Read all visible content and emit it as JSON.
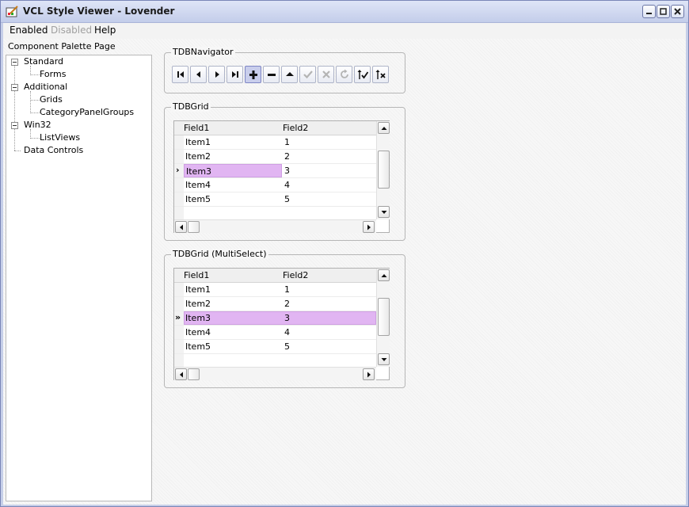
{
  "window": {
    "title": "VCL Style Viewer - Lovender",
    "icon": "paint-palette-icon",
    "controls": [
      "minimize-icon",
      "maximize-icon",
      "close-icon"
    ]
  },
  "menu": {
    "items": [
      {
        "label": "Enabled",
        "enabled": true
      },
      {
        "label": "Disabled",
        "enabled": false
      },
      {
        "label": "Help",
        "enabled": true
      }
    ]
  },
  "palette": {
    "label": "Component Palette Page",
    "tree": [
      {
        "label": "Standard",
        "children": [
          "Forms"
        ]
      },
      {
        "label": "Additional",
        "children": [
          "Grids",
          "CategoryPanelGroups"
        ]
      },
      {
        "label": "Win32",
        "children": [
          "ListViews"
        ]
      },
      {
        "label": "Data Controls",
        "children": []
      }
    ]
  },
  "navigator": {
    "caption": "TDBNavigator",
    "buttons": [
      {
        "name": "first",
        "icon": "first-record-icon",
        "enabled": true
      },
      {
        "name": "prior",
        "icon": "prior-record-icon",
        "enabled": true
      },
      {
        "name": "next",
        "icon": "next-record-icon",
        "enabled": true
      },
      {
        "name": "last",
        "icon": "last-record-icon",
        "enabled": true
      },
      {
        "name": "insert",
        "icon": "plus-icon",
        "enabled": true,
        "active": true
      },
      {
        "name": "delete",
        "icon": "minus-icon",
        "enabled": true
      },
      {
        "name": "edit",
        "icon": "edit-up-icon",
        "enabled": true
      },
      {
        "name": "post",
        "icon": "check-icon",
        "enabled": false
      },
      {
        "name": "cancel",
        "icon": "cancel-x-icon",
        "enabled": false
      },
      {
        "name": "refresh",
        "icon": "refresh-icon",
        "enabled": false
      },
      {
        "name": "apply-updates",
        "icon": "apply-updates-icon",
        "enabled": true
      },
      {
        "name": "cancel-updates",
        "icon": "cancel-updates-icon",
        "enabled": true
      }
    ]
  },
  "grid1": {
    "caption": "TDBGrid",
    "columns": [
      "Field1",
      "Field2"
    ],
    "rows": [
      {
        "field1": "Item1",
        "field2": "1"
      },
      {
        "field1": "Item2",
        "field2": "2"
      },
      {
        "field1": "Item3",
        "field2": "3"
      },
      {
        "field1": "Item4",
        "field2": "4"
      },
      {
        "field1": "Item5",
        "field2": "5"
      }
    ],
    "current_row": 2,
    "indicator": "›"
  },
  "grid2": {
    "caption": "TDBGrid (MultiSelect)",
    "columns": [
      "Field1",
      "Field2"
    ],
    "rows": [
      {
        "field1": "Item1",
        "field2": "1"
      },
      {
        "field1": "Item2",
        "field2": "2"
      },
      {
        "field1": "Item3",
        "field2": "3"
      },
      {
        "field1": "Item4",
        "field2": "4"
      },
      {
        "field1": "Item5",
        "field2": "5"
      }
    ],
    "current_row": 2,
    "indicator": "»"
  },
  "colors": {
    "selection": "#e1b5f2",
    "nav_active": "#c9ceec"
  }
}
